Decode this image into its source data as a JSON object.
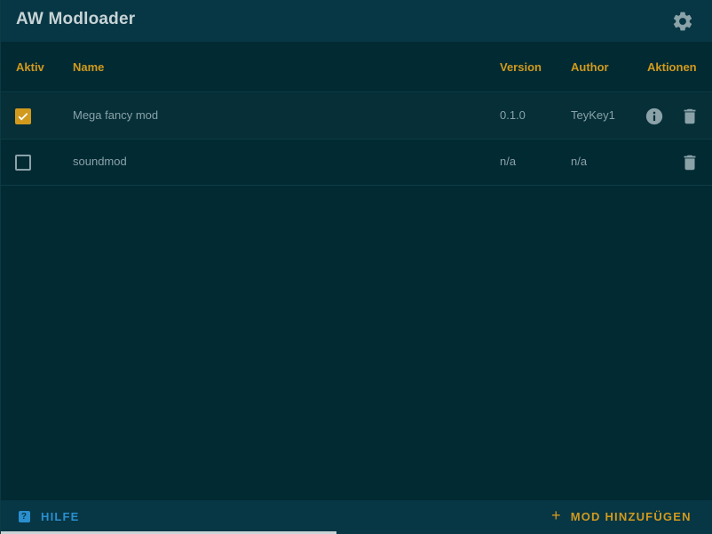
{
  "app": {
    "title": "AW Modloader"
  },
  "table": {
    "headers": {
      "active": "Aktiv",
      "name": "Name",
      "version": "Version",
      "author": "Author",
      "actions": "Aktionen"
    },
    "rows": [
      {
        "active": true,
        "name": "Mega fancy mod",
        "version": "0.1.0",
        "author": "TeyKey1",
        "actions": [
          "info-icon",
          "delete-icon"
        ]
      },
      {
        "active": false,
        "name": "soundmod",
        "version": "n/a",
        "author": "n/a",
        "actions": [
          "delete-icon"
        ]
      }
    ]
  },
  "footer": {
    "help_label": "HILFE",
    "add_label": "MOD HINZUFÜGEN"
  },
  "colors": {
    "accent": "#d19a1d",
    "link": "#2a8fcf",
    "background": "#022a33",
    "bar": "#073644"
  }
}
